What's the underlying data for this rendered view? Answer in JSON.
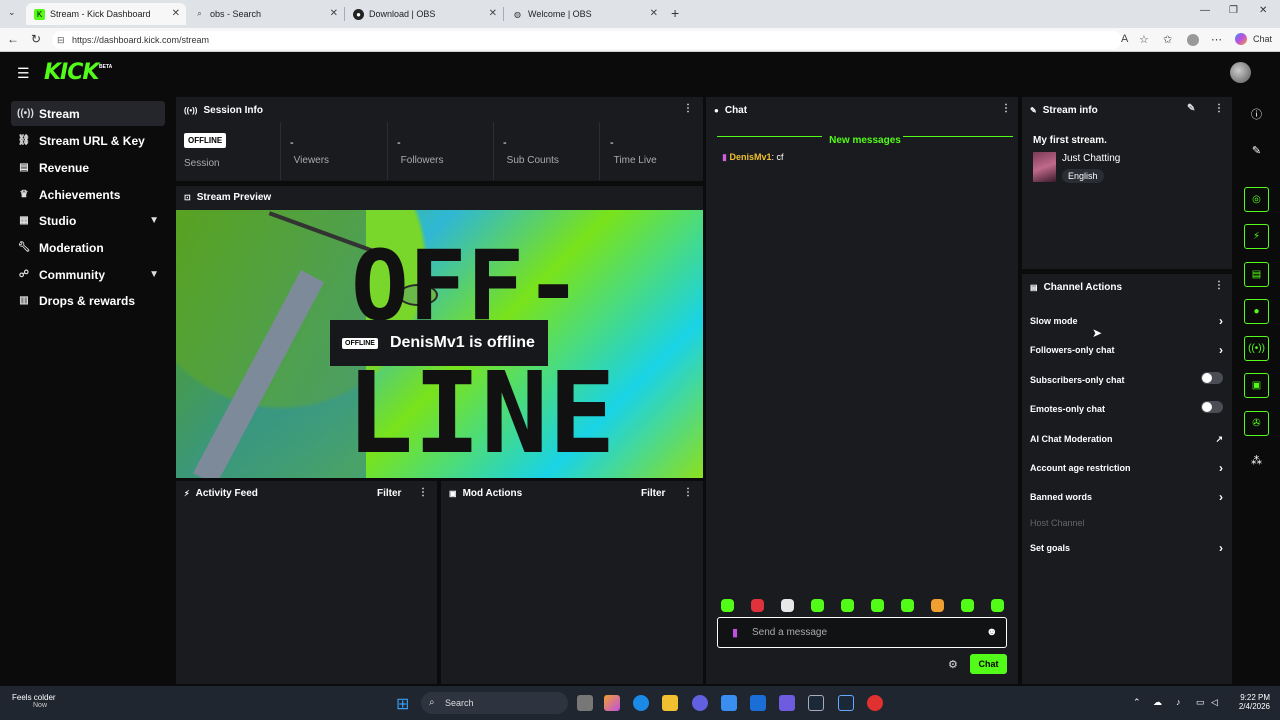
{
  "browser": {
    "tabs": [
      {
        "label": "Stream - Kick Dashboard",
        "icon": "kick-icon",
        "active": true
      },
      {
        "label": "obs - Search",
        "icon": "search-icon",
        "active": false
      },
      {
        "label": "Download | OBS",
        "icon": "obs-icon",
        "active": false
      },
      {
        "label": "Welcome | OBS",
        "icon": "globe-icon",
        "active": false
      }
    ],
    "url": "https://dashboard.kick.com/stream",
    "chat_button": "Chat"
  },
  "header": {
    "logo": "KICK",
    "beta": "BETA"
  },
  "nav": [
    {
      "label": "Stream",
      "icon": "broadcast-icon",
      "active": true,
      "expandable": false
    },
    {
      "label": "Stream URL & Key",
      "icon": "link-icon",
      "active": false,
      "expandable": false
    },
    {
      "label": "Revenue",
      "icon": "revenue-icon",
      "active": false,
      "expandable": false
    },
    {
      "label": "Achievements",
      "icon": "trophy-icon",
      "active": false,
      "expandable": false
    },
    {
      "label": "Studio",
      "icon": "studio-icon",
      "active": false,
      "expandable": true
    },
    {
      "label": "Moderation",
      "icon": "wrench-icon",
      "active": false,
      "expandable": false
    },
    {
      "label": "Community",
      "icon": "community-icon",
      "active": false,
      "expandable": true
    },
    {
      "label": "Drops & rewards",
      "icon": "drops-icon",
      "active": false,
      "expandable": false
    }
  ],
  "session": {
    "title": "Session Info",
    "badge": "OFFLINE",
    "stats": [
      {
        "label": "Session",
        "value": ""
      },
      {
        "label": "Viewers",
        "value": "-"
      },
      {
        "label": "Followers",
        "value": "-"
      },
      {
        "label": "Sub Counts",
        "value": "-"
      },
      {
        "label": "Time Live",
        "value": "-"
      }
    ]
  },
  "preview": {
    "title": "Stream Preview",
    "art_line1": "OFF-",
    "art_line2": "LINE",
    "badge": "OFFLINE",
    "message": "DenisMv1 is offline"
  },
  "activity": {
    "title": "Activity Feed",
    "filter": "Filter"
  },
  "mod_actions": {
    "title": "Mod Actions",
    "filter": "Filter"
  },
  "chat": {
    "title": "Chat",
    "new_messages": "New messages",
    "messages": [
      {
        "user": "DenisMv1",
        "text": "cf",
        "user_color": "#f0c030"
      }
    ],
    "placeholder": "Send a message",
    "send": "Chat",
    "emote_colors": [
      "#53fc18",
      "#e0323c",
      "#e8e8e8",
      "#53fc18",
      "#53fc18",
      "#53fc18",
      "#53fc18",
      "#f0a030",
      "#53fc18",
      "#53fc18"
    ]
  },
  "stream_info": {
    "title": "Stream info",
    "stream_title": "My first stream.",
    "category": "Just Chatting",
    "language": "English"
  },
  "channel_actions": {
    "title": "Channel Actions",
    "items": [
      {
        "label": "Slow mode",
        "control": "arrow"
      },
      {
        "label": "Followers-only chat",
        "control": "arrow"
      },
      {
        "label": "Subscribers-only chat",
        "control": "toggle",
        "on": false
      },
      {
        "label": "Emotes-only chat",
        "control": "toggle",
        "on": false
      },
      {
        "label": "AI Chat Moderation",
        "control": "external"
      },
      {
        "label": "Account age restriction",
        "control": "arrow"
      },
      {
        "label": "Banned words",
        "control": "arrow"
      },
      {
        "label": "Host Channel",
        "control": "none",
        "disabled": true
      },
      {
        "label": "Set goals",
        "control": "arrow"
      }
    ]
  },
  "taskbar": {
    "weather": "Feels colder",
    "weather_sub": "Now",
    "search": "Search",
    "time": "9:22 PM",
    "date": "2/4/2026"
  },
  "colors": {
    "accent": "#53fc18",
    "panel": "#191b1f",
    "background": "#0b0b0c"
  }
}
